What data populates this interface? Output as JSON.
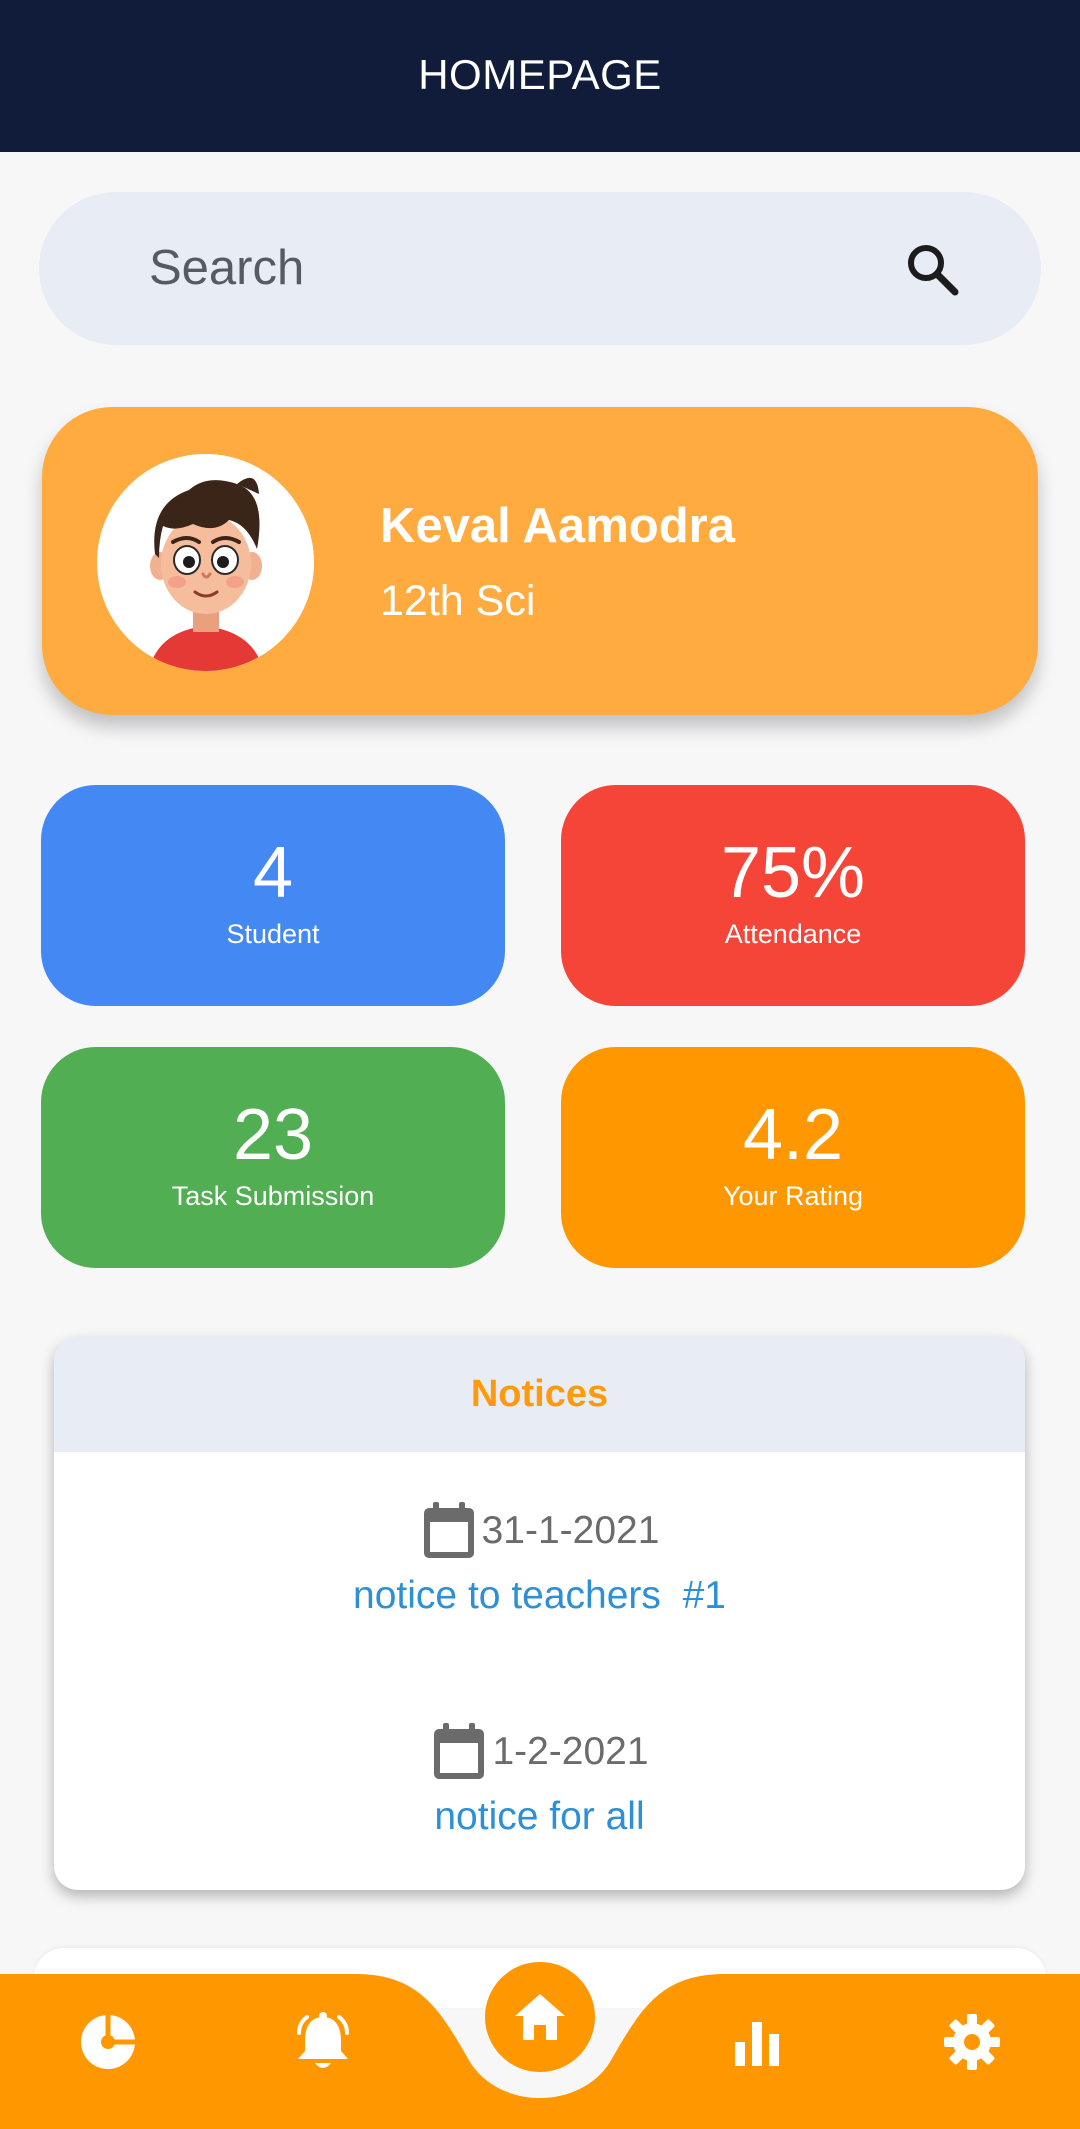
{
  "app_bar": {
    "title": "HOMEPAGE"
  },
  "search": {
    "placeholder": "Search"
  },
  "profile": {
    "name": "Keval Aamodra",
    "class": "12th Sci"
  },
  "stats": [
    {
      "value": "4",
      "label": "Student",
      "color": "#4488f4"
    },
    {
      "value": "75%",
      "label": "Attendance",
      "color": "#f44538"
    },
    {
      "value": "23",
      "label": "Task Submission",
      "color": "#52ae52"
    },
    {
      "value": "4.2",
      "label": "Your Rating",
      "color": "#ff9800"
    }
  ],
  "notices": {
    "title": "Notices",
    "items": [
      {
        "date": "31-1-2021",
        "title": "notice to teachers  #1"
      },
      {
        "date": "1-2-2021",
        "title": "notice for all"
      }
    ]
  },
  "bottom_nav": {
    "items": [
      "dashboard-icon",
      "bell-icon",
      "home-icon",
      "bar-chart-icon",
      "settings-icon"
    ],
    "selected": "home-icon",
    "color": "#ff9800"
  },
  "colors": {
    "app_bar": "#101c3a",
    "profile_card": "#ffab40",
    "accent": "#ff9800",
    "link": "#2d8fd5"
  }
}
